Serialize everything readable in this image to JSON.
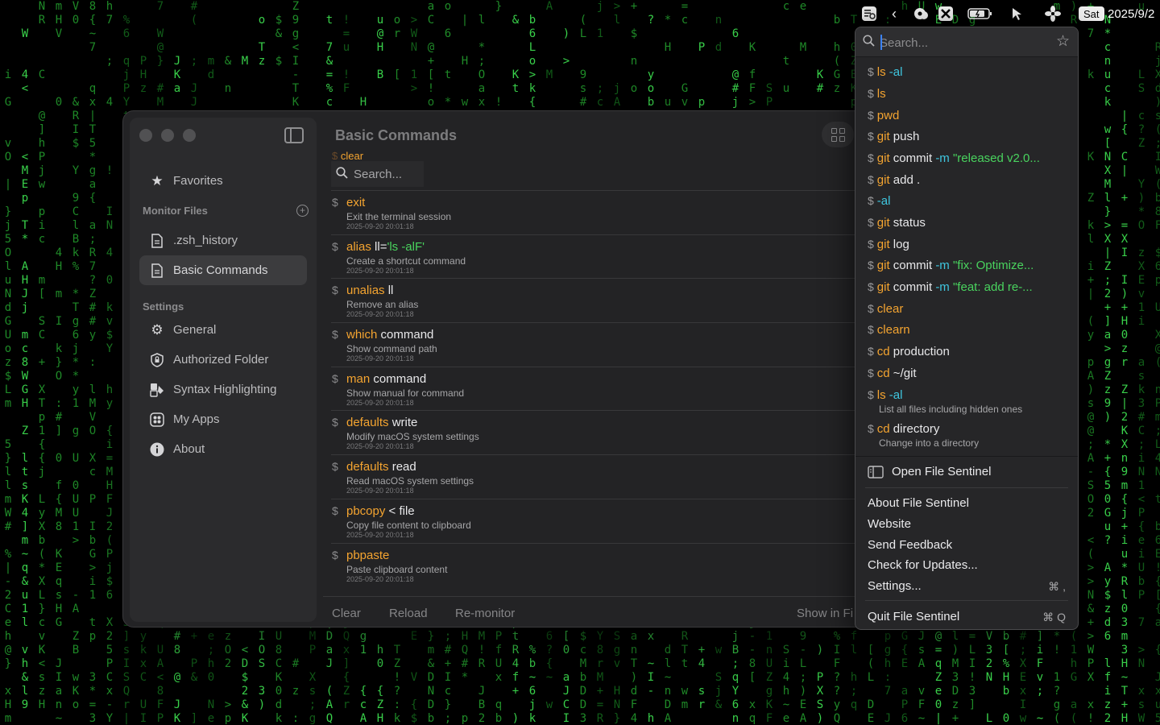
{
  "menubar": {
    "day": "Sat",
    "date": "2025/9/2"
  },
  "sidebar": {
    "favorites": "Favorites",
    "monitor_header": "Monitor Files",
    "files": [
      ".zsh_history",
      "Basic Commands"
    ],
    "settings_header": "Settings",
    "settings_items": [
      "General",
      "Authorized Folder",
      "Syntax Highlighting",
      "My Apps",
      "About"
    ]
  },
  "content": {
    "title": "Basic Commands",
    "ghost_row": "clear",
    "search_placeholder": "Search...",
    "rows": [
      {
        "parts": [
          {
            "t": "exit",
            "c": "kw"
          }
        ],
        "desc": "Exit the terminal session",
        "ts": "2025-09-20 20:01:18"
      },
      {
        "parts": [
          {
            "t": "alias",
            "c": "kw"
          },
          {
            "t": " ll=",
            "c": ""
          },
          {
            "t": "'ls -alF'",
            "c": "str"
          }
        ],
        "desc": "Create a shortcut command",
        "ts": "2025-09-20 20:01:18"
      },
      {
        "parts": [
          {
            "t": "unalias",
            "c": "kw"
          },
          {
            "t": " ll",
            "c": ""
          }
        ],
        "desc": "Remove an alias",
        "ts": "2025-09-20 20:01:18"
      },
      {
        "parts": [
          {
            "t": "which",
            "c": "kw"
          },
          {
            "t": " command",
            "c": ""
          }
        ],
        "desc": "Show command path",
        "ts": "2025-09-20 20:01:18"
      },
      {
        "parts": [
          {
            "t": "man",
            "c": "kw"
          },
          {
            "t": " command",
            "c": ""
          }
        ],
        "desc": "Show manual for command",
        "ts": "2025-09-20 20:01:18"
      },
      {
        "parts": [
          {
            "t": "defaults",
            "c": "kw"
          },
          {
            "t": " write",
            "c": ""
          }
        ],
        "desc": "Modify macOS system settings",
        "ts": "2025-09-20 20:01:18"
      },
      {
        "parts": [
          {
            "t": "defaults",
            "c": "kw"
          },
          {
            "t": " read",
            "c": ""
          }
        ],
        "desc": "Read macOS system settings",
        "ts": "2025-09-20 20:01:18"
      },
      {
        "parts": [
          {
            "t": "pbcopy",
            "c": "kw"
          },
          {
            "t": " < file",
            "c": ""
          }
        ],
        "desc": "Copy file content to clipboard",
        "ts": "2025-09-20 20:01:18"
      },
      {
        "parts": [
          {
            "t": "pbpaste",
            "c": "kw"
          }
        ],
        "desc": "Paste clipboard content",
        "ts": "2025-09-20 20:01:18"
      }
    ],
    "footer": {
      "clear": "Clear",
      "reload": "Reload",
      "remonitor": "Re-monitor",
      "show_in": "Show in Fi"
    }
  },
  "menu": {
    "search_placeholder": "Search...",
    "dollar": "$",
    "items": [
      {
        "parts": [
          {
            "t": "ls",
            "c": "kw"
          },
          {
            "t": " -al",
            "c": "fl"
          }
        ]
      },
      {
        "parts": [
          {
            "t": "ls",
            "c": "kw"
          }
        ]
      },
      {
        "parts": [
          {
            "t": "pwd",
            "c": "kw"
          }
        ]
      },
      {
        "parts": [
          {
            "t": "git",
            "c": "kw"
          },
          {
            "t": " push",
            "c": ""
          }
        ]
      },
      {
        "parts": [
          {
            "t": "git",
            "c": "kw"
          },
          {
            "t": " commit ",
            "c": ""
          },
          {
            "t": "-m",
            "c": "fl"
          },
          {
            "t": " \"released v2.0...",
            "c": "str"
          }
        ]
      },
      {
        "parts": [
          {
            "t": "git",
            "c": "kw"
          },
          {
            "t": " add .",
            "c": ""
          }
        ]
      },
      {
        "parts": [
          {
            "t": "-al",
            "c": "fl"
          }
        ]
      },
      {
        "parts": [
          {
            "t": "git",
            "c": "kw"
          },
          {
            "t": " status",
            "c": ""
          }
        ]
      },
      {
        "parts": [
          {
            "t": "git",
            "c": "kw"
          },
          {
            "t": " log",
            "c": ""
          }
        ]
      },
      {
        "parts": [
          {
            "t": "git",
            "c": "kw"
          },
          {
            "t": " commit ",
            "c": ""
          },
          {
            "t": "-m",
            "c": "fl"
          },
          {
            "t": " \"fix: Optimize...",
            "c": "str"
          }
        ]
      },
      {
        "parts": [
          {
            "t": "git",
            "c": "kw"
          },
          {
            "t": " commit ",
            "c": ""
          },
          {
            "t": "-m",
            "c": "fl"
          },
          {
            "t": " \"feat: add re-...",
            "c": "str"
          }
        ]
      },
      {
        "parts": [
          {
            "t": "clear",
            "c": "kw"
          }
        ]
      },
      {
        "parts": [
          {
            "t": "clearn",
            "c": "kw"
          }
        ]
      },
      {
        "parts": [
          {
            "t": "cd",
            "c": "kw"
          },
          {
            "t": " production",
            "c": ""
          }
        ]
      },
      {
        "parts": [
          {
            "t": "cd",
            "c": "kw"
          },
          {
            "t": " ~/git",
            "c": ""
          }
        ]
      },
      {
        "parts": [
          {
            "t": "ls",
            "c": "kw"
          },
          {
            "t": " -al",
            "c": "fl"
          }
        ],
        "sub": "List all files including hidden ones"
      },
      {
        "parts": [
          {
            "t": "cd",
            "c": "kw"
          },
          {
            "t": " directory",
            "c": ""
          }
        ],
        "sub": "Change into a directory"
      }
    ],
    "open": "Open File Sentinel",
    "about": "About File Sentinel",
    "website": "Website",
    "feedback": "Send Feedback",
    "updates": "Check for Updates...",
    "settings": "Settings...",
    "settings_key": "⌘ ,",
    "quit": "Quit File Sentinel",
    "quit_key": "⌘ Q"
  },
  "colors": {
    "keyword": "#f4a430",
    "string": "#49d35e",
    "flag": "#3fc7e0",
    "matrix": "#1f8a28"
  }
}
